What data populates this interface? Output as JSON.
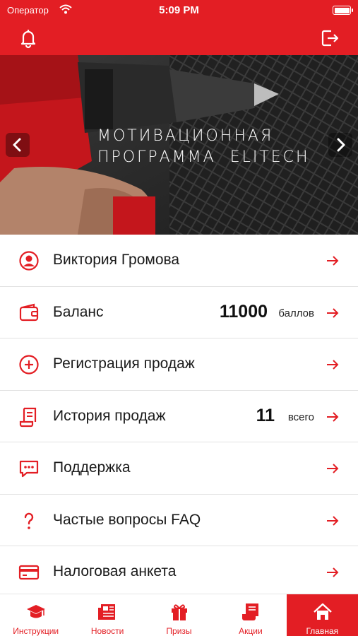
{
  "status_bar": {
    "carrier": "Оператор",
    "time": "5:09 PM"
  },
  "header": {
    "left_icon": "bell-icon",
    "right_icon": "logout-icon"
  },
  "banner": {
    "title_line1": "МОТИВАЦИОННАЯ",
    "title_line2": "ПРОГРАММА  ELITECH"
  },
  "menu": [
    {
      "label": "Виктория Громова",
      "icon": "user-icon"
    },
    {
      "label": "Баланс",
      "icon": "wallet-icon",
      "value": "11000",
      "unit": "баллов"
    },
    {
      "label": "Регистрация продаж",
      "icon": "plus-circle-icon"
    },
    {
      "label": "История продаж",
      "icon": "receipt-icon",
      "value": "11",
      "unit": "всего"
    },
    {
      "label": "Поддержка",
      "icon": "chat-icon"
    },
    {
      "label": "Частые вопросы FAQ",
      "icon": "question-icon"
    },
    {
      "label": "Налоговая анкета",
      "icon": "card-icon"
    }
  ],
  "tabs": [
    {
      "label": "Инструкции",
      "icon": "graduation-cap-icon"
    },
    {
      "label": "Новости",
      "icon": "newspaper-icon"
    },
    {
      "label": "Призы",
      "icon": "gift-icon"
    },
    {
      "label": "Акции",
      "icon": "ticket-icon"
    },
    {
      "label": "Главная",
      "icon": "home-icon",
      "active": true
    }
  ],
  "colors": {
    "accent": "#e31e24",
    "text": "#1a1a1a",
    "divider": "#e2e2e2"
  }
}
